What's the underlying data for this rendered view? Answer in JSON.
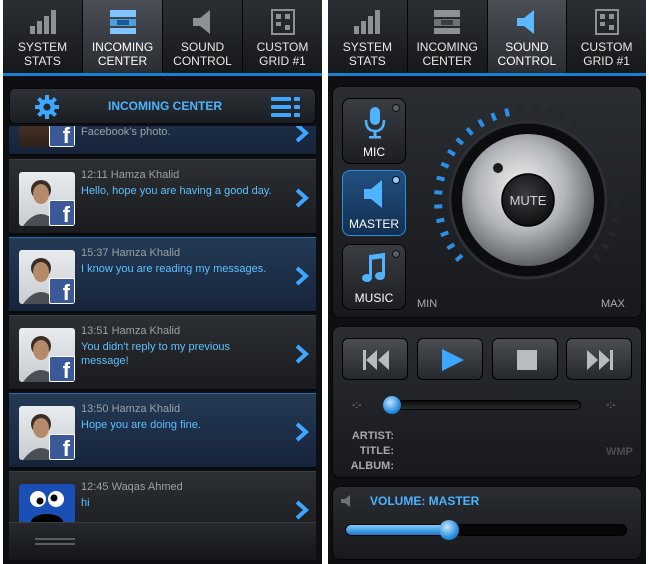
{
  "tabs": [
    {
      "line1": "SYSTEM",
      "line2": "STATS",
      "icon": "signal-bars-icon"
    },
    {
      "line1": "INCOMING",
      "line2": "CENTER",
      "icon": "inbox-icon"
    },
    {
      "line1": "SOUND",
      "line2": "CONTROL",
      "icon": "speaker-icon"
    },
    {
      "line1": "CUSTOM",
      "line2": "GRID #1",
      "icon": "grid-icon"
    }
  ],
  "left_active_tab": "INCOMING CENTER",
  "right_active_tab": "SOUND CONTROL",
  "incoming": {
    "title": "INCOMING CENTER",
    "top_partial": "Facebook's photo.",
    "messages": [
      {
        "time": "12:11",
        "name": "Hamza Khalid",
        "text": "Hello, hope you are having a good day.",
        "highlighted": false
      },
      {
        "time": "15:37",
        "name": "Hamza Khalid",
        "text": "I know you are reading my messages.",
        "highlighted": true
      },
      {
        "time": "13:51",
        "name": "Hamza Khalid",
        "text": "You didn't reply to my previous message!",
        "highlighted": false
      },
      {
        "time": "13:50",
        "name": "Hamza Khalid",
        "text": "Hope you are doing fine.",
        "highlighted": true
      },
      {
        "time": "12:45",
        "name": "Waqas Ahmed",
        "text": "hi",
        "highlighted": false
      }
    ]
  },
  "sound": {
    "sources": [
      {
        "label": "MIC",
        "icon": "microphone-icon",
        "active": false
      },
      {
        "label": "MASTER",
        "icon": "speaker-icon",
        "active": true
      },
      {
        "label": "MUSIC",
        "icon": "music-note-icon",
        "active": false
      }
    ],
    "knob_label": "MUTE",
    "min_label": "MIN",
    "max_label": "MAX",
    "level": 0.45,
    "seek_start": "-:-",
    "seek_end": "-:-",
    "artist_label": "ARTIST:",
    "title_label": "TITLE:",
    "album_label": "ALBUM:",
    "player_name": "WMP",
    "volume_label": "VOLUME: MASTER",
    "volume_level": 0.37,
    "seek_position": 0.0
  },
  "colors": {
    "accent": "#1b7fd0",
    "text_blue": "#5ec0ff",
    "facebook": "#3b5998"
  }
}
